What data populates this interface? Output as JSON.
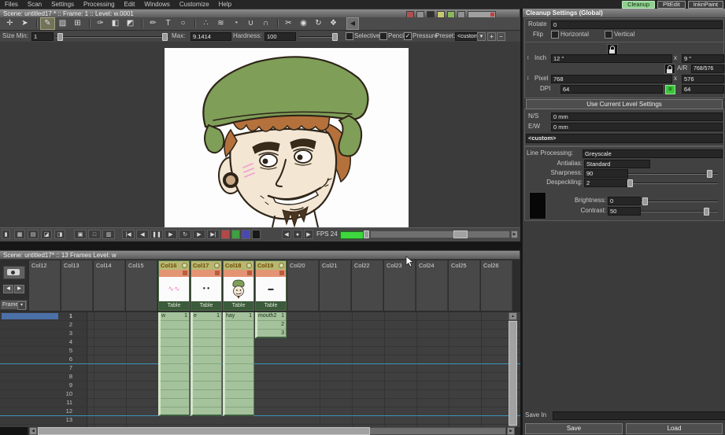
{
  "menu": {
    "items": [
      "Files",
      "Scan",
      "Settings",
      "Processing",
      "Edit",
      "Windows",
      "Customize",
      "Help"
    ]
  },
  "rooms": {
    "tabs": [
      {
        "label": "Cleanup",
        "active": true
      },
      {
        "label": "PltEdit",
        "active": false
      },
      {
        "label": "InknPaint",
        "active": false
      }
    ]
  },
  "viewer": {
    "title": "Scene: untitled17 * :: Frame: 1 :: Level: w.0001",
    "toggle_icons": [
      "safe-area-icon",
      "field-guide-icon",
      "blank-view-icon",
      "camera-view-icon",
      "camstand-view-icon",
      "freeze-icon",
      "preview-toggle-icon"
    ]
  },
  "toolbar": {
    "groups": [
      [
        {
          "name": "animate",
          "glyph": "✛"
        },
        {
          "name": "selection",
          "glyph": "➤"
        }
      ],
      [
        {
          "name": "brush",
          "glyph": "✎",
          "selected": true
        },
        {
          "name": "eraser",
          "glyph": "▨"
        },
        {
          "name": "tape",
          "glyph": "⊞"
        }
      ],
      [
        {
          "name": "style-picker",
          "glyph": "✑"
        },
        {
          "name": "rgb-picker",
          "glyph": "◧"
        },
        {
          "name": "fill",
          "glyph": "◩"
        }
      ],
      [
        {
          "name": "paint-brush",
          "glyph": "✏"
        },
        {
          "name": "type",
          "glyph": "T"
        },
        {
          "name": "geometric",
          "glyph": "○"
        }
      ],
      [
        {
          "name": "control-point-editor",
          "glyph": "∴"
        },
        {
          "name": "pinch",
          "glyph": "≋"
        },
        {
          "name": "pump",
          "glyph": "◔"
        },
        {
          "name": "magnet",
          "glyph": "∪"
        },
        {
          "name": "bender",
          "glyph": "∩"
        }
      ],
      [
        {
          "name": "cutter",
          "glyph": "✂"
        },
        {
          "name": "zoom",
          "glyph": "◉"
        },
        {
          "name": "rotate",
          "glyph": "↻"
        },
        {
          "name": "hand",
          "glyph": "❖"
        }
      ]
    ],
    "collapse_glyph": "◀"
  },
  "tool_options": {
    "size_min_label": "Size Min:",
    "size_min_value": "1",
    "max_label": "Max:",
    "max_value": "9.1414",
    "hardness_label": "Hardness:",
    "hardness_value": "100",
    "selective_label": "Selective",
    "pencil_label": "Pencil",
    "pressure_label": "Pressure",
    "pressure_checked_glyph": "✓",
    "preset_label": "Preset:",
    "preset_value": "<custom>",
    "preset_dropdown_glyph": "▾",
    "add_glyph": "+",
    "remove_glyph": "−"
  },
  "playback": {
    "view_buttons": [
      {
        "name": "playback-options",
        "glyph": "▮"
      },
      {
        "name": "camera-view",
        "glyph": "▦"
      },
      {
        "name": "camstand-view",
        "glyph": "▤"
      },
      {
        "name": "3d-view",
        "glyph": "◪"
      },
      {
        "name": "compare-view",
        "glyph": "◨"
      }
    ],
    "guide_buttons": [
      {
        "name": "field-guide",
        "glyph": "▣"
      },
      {
        "name": "safe-area",
        "glyph": "□"
      },
      {
        "name": "camera-test",
        "glyph": "▥"
      }
    ],
    "transport_buttons": [
      {
        "name": "first-frame",
        "glyph": "|◀"
      },
      {
        "name": "prev-frame",
        "glyph": "◀"
      },
      {
        "name": "pause",
        "glyph": "❚❚"
      },
      {
        "name": "play",
        "glyph": "▶"
      },
      {
        "name": "loop",
        "glyph": "↻"
      },
      {
        "name": "next-frame",
        "glyph": "▶"
      },
      {
        "name": "last-frame",
        "glyph": "▶|"
      }
    ],
    "channel_buttons": [
      {
        "name": "red-channel",
        "color": "#b24848"
      },
      {
        "name": "green-channel",
        "color": "#3fa03f"
      },
      {
        "name": "blue-channel",
        "color": "#4848b2"
      },
      {
        "name": "matte-channel",
        "color": "#181818"
      }
    ],
    "stepper": [
      {
        "name": "step-back",
        "glyph": "◀"
      },
      {
        "name": "current-frame-indicator",
        "glyph": "●"
      },
      {
        "name": "step-forward",
        "glyph": "▶"
      }
    ],
    "fps_label": "FPS 24"
  },
  "xsheet": {
    "title": "Scene: untitled17* :: 13 Frames  Level: w",
    "frame_label": "Frame",
    "frames": 13,
    "current_frame": 1,
    "columns_left": [
      "Col12",
      "Col13",
      "Col14",
      "Col15"
    ],
    "active_columns": [
      {
        "name": "Col16",
        "level": "w",
        "table_label": "Table",
        "thumb": "pink-scribble",
        "start": 1,
        "end": 12
      },
      {
        "name": "Col17",
        "level": "e",
        "table_label": "Table",
        "thumb": "two-dots",
        "start": 1,
        "end": 12
      },
      {
        "name": "Col18",
        "level": "hay",
        "table_label": "Table",
        "thumb": "character-head",
        "start": 1,
        "end": 12
      },
      {
        "name": "Col19",
        "level": "mouth2",
        "table_label": "Table",
        "thumb": "mouth-line",
        "start": 1,
        "end": 3
      }
    ],
    "columns_right": [
      "Col20",
      "Col21",
      "Col22",
      "Col23",
      "Col24",
      "Col25",
      "Col26"
    ]
  },
  "cleanup": {
    "title": "Cleanup Settings (Global)",
    "rotate_label": "Rotate",
    "rotate_value": "0",
    "flip_label": "Flip",
    "horizontal_label": "Horizontal",
    "vertical_label": "Vertical",
    "inch_label": "Inch",
    "inch_w": "12 ″",
    "inch_h": "9 ″",
    "dim_x": "x",
    "ar_label": "A/R",
    "ar_value": "768/576",
    "pixel_label": "Pixel",
    "pixel_w": "768",
    "pixel_h": "576",
    "dpi_label": "DPI",
    "dpi_value": "64",
    "dpi_link_glyph": "=",
    "dpi_value2": "64",
    "use_current_label": "Use Current Level Settings",
    "ns_label": "N/S",
    "ns_value": "0 mm",
    "ew_label": "E/W",
    "ew_value": "0 mm",
    "camera_preset": "<custom>",
    "line_processing_label": "Line Processing:",
    "line_processing_value": "Greyscale",
    "antialias_label": "Antialias:",
    "antialias_value": "Standard",
    "sharpness_label": "Sharpness:",
    "sharpness_value": "90",
    "despeckling_label": "Despeckling:",
    "despeckling_value": "2",
    "brightness_label": "Brightness:",
    "brightness_value": "0",
    "contrast_label": "Contrast:",
    "contrast_value": "50",
    "save_in_label": "Save In",
    "save_label": "Save",
    "load_label": "Load"
  },
  "icons": {
    "dropdown": "▾",
    "swap": "↕",
    "scroll_up": "▲",
    "scroll_left": "◀",
    "scroll_right": "▶"
  }
}
